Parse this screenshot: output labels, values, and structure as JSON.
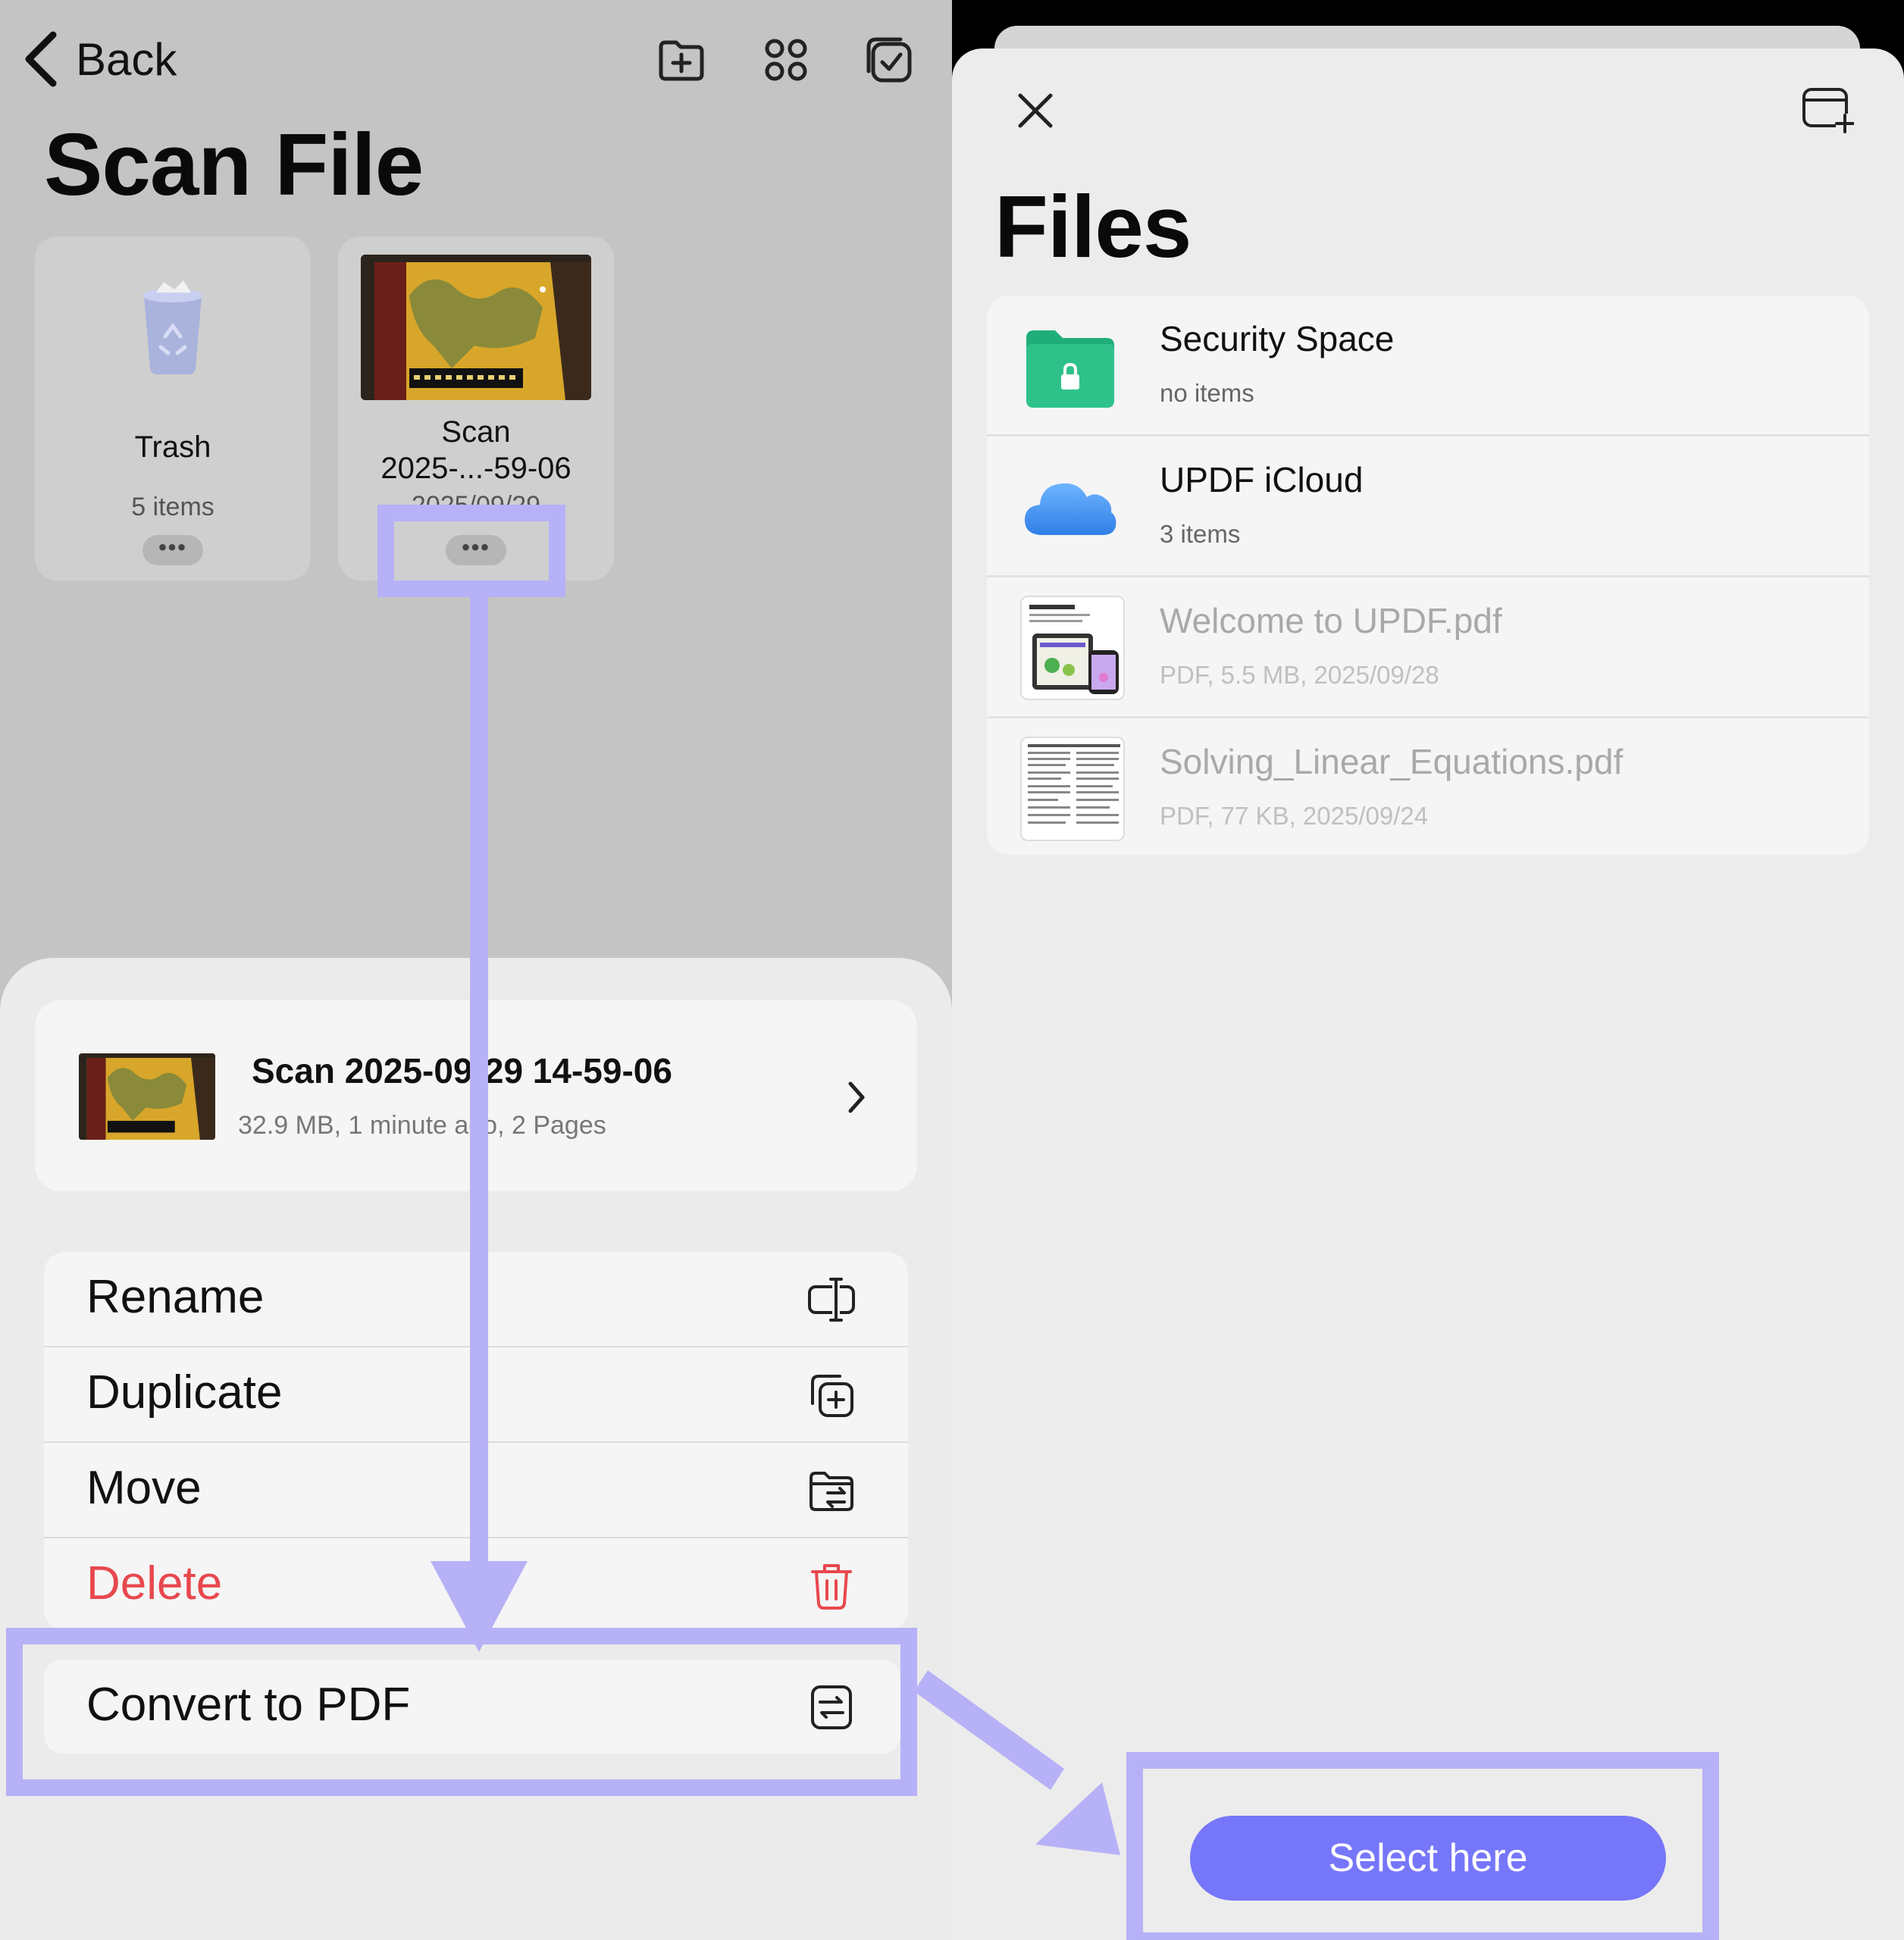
{
  "left": {
    "nav": {
      "back_label": "Back"
    },
    "title": "Scan File",
    "tiles": [
      {
        "name": "Trash",
        "sub": "5 items",
        "more": "•••"
      },
      {
        "name_line1": "Scan",
        "name_line2": "2025-...-59-06",
        "date": "2025/09/29",
        "more": "•••"
      }
    ],
    "file_card": {
      "title": "Scan 2025-09-29 14-59-06",
      "meta": "32.9 MB, 1 minute ago, 2 Pages"
    },
    "menu": [
      {
        "label": "Rename",
        "icon": "rename-icon"
      },
      {
        "label": "Duplicate",
        "icon": "duplicate-icon"
      },
      {
        "label": "Move",
        "icon": "move-folder-icon"
      },
      {
        "label": "Delete",
        "icon": "trash-icon",
        "color": "#e8484e"
      }
    ],
    "convert": {
      "label": "Convert to PDF",
      "icon": "convert-icon"
    }
  },
  "right": {
    "title": "Files",
    "rows": [
      {
        "title": "Security Space",
        "sub": "no items",
        "icon": "lock-folder-icon"
      },
      {
        "title": "UPDF iCloud",
        "sub": "3 items",
        "icon": "cloud-icon"
      },
      {
        "title": "Welcome to UPDF.pdf",
        "sub": "PDF, 5.5 MB, 2025/09/28",
        "icon": "pdf-thumbnail"
      },
      {
        "title": "Solving_Linear_Equations.pdf",
        "sub": "PDF, 77 KB, 2025/09/24",
        "icon": "pdf-thumbnail"
      }
    ],
    "select_button": "Select here"
  },
  "colors": {
    "accent": "#7676fa",
    "highlight": "#b7b1f7",
    "delete": "#e8484e",
    "folder_green": "#2ec28a",
    "cloud_blue": "#4a9df5"
  }
}
